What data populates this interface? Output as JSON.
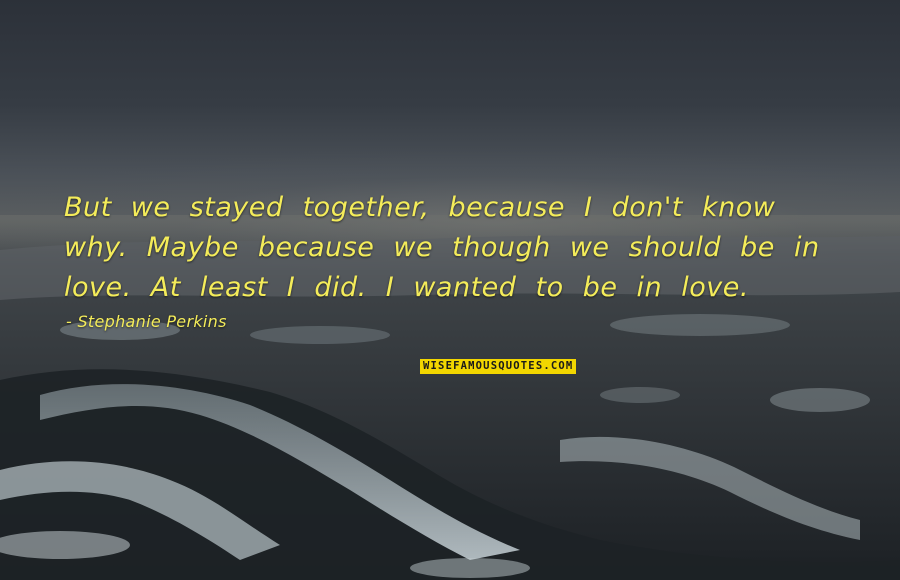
{
  "quote": {
    "lines": [
      "But we stayed together, because I don't know",
      "why. Maybe because we though we should be in",
      "love. At least I did. I wanted to be in love."
    ],
    "author": "- Stephanie Perkins"
  },
  "watermark": {
    "text": "WISEFAMOUSQUOTES.COM"
  },
  "colors": {
    "quote_text": "#f4ec5a",
    "watermark_bg": "#f2d600",
    "watermark_text": "#1a1a1a"
  }
}
